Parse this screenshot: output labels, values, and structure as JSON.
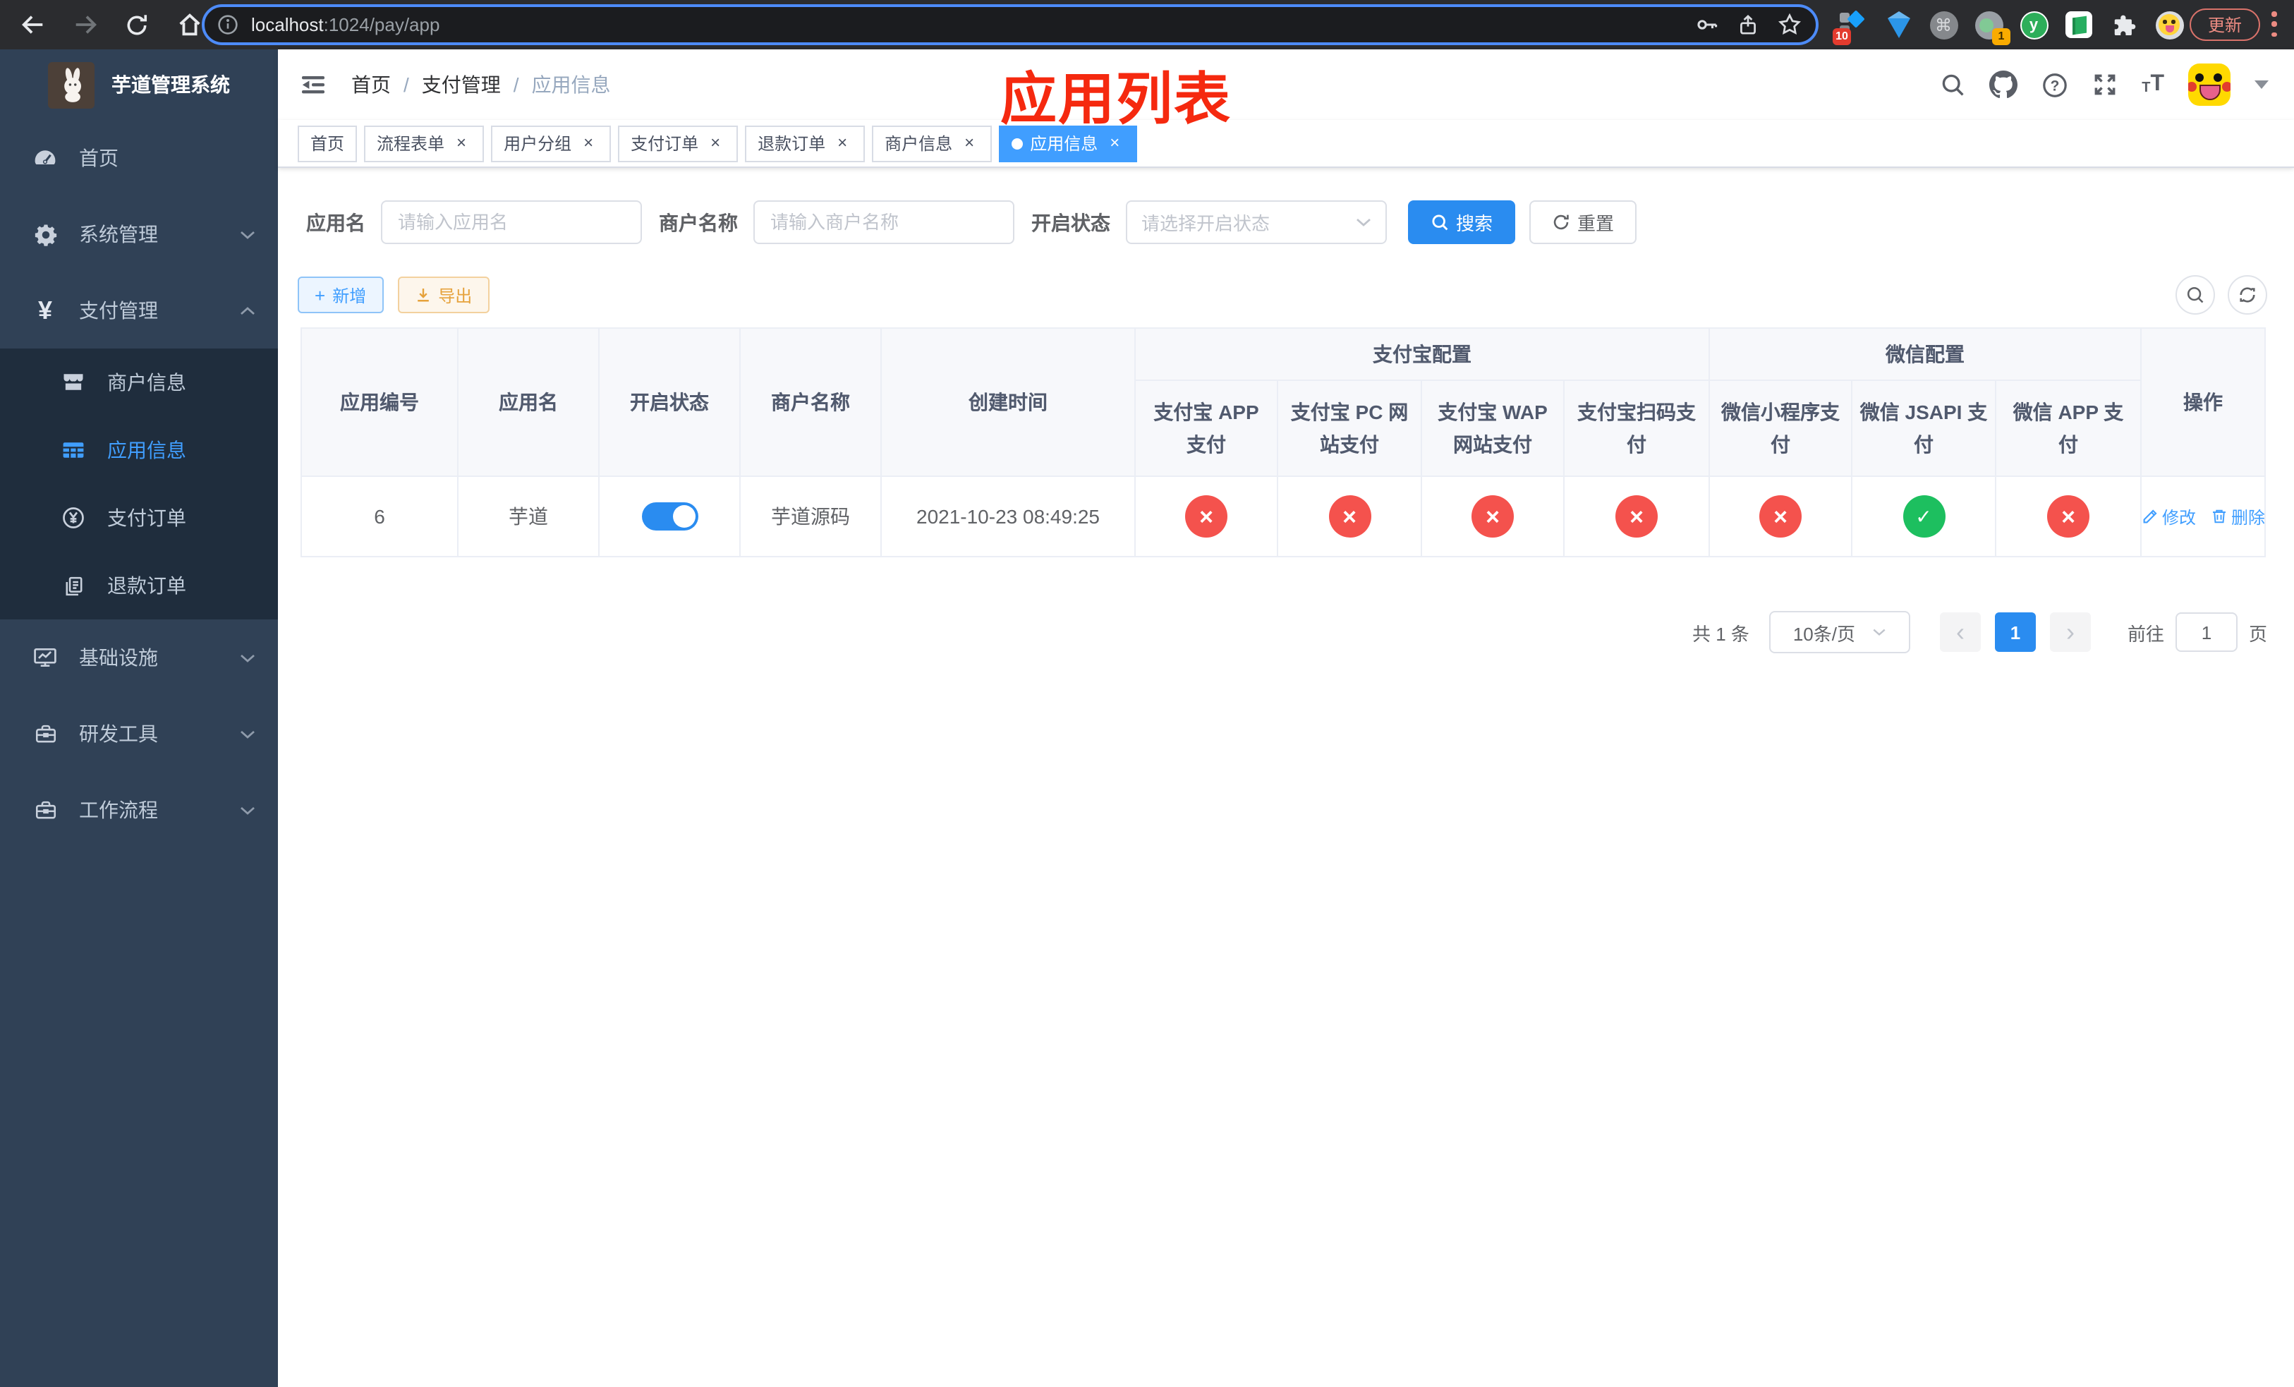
{
  "browser": {
    "url_host": "localhost",
    "url_path": ":1024/pay/app",
    "update_button": "更新",
    "ext_badge_red": "10",
    "ext_badge_orange": "1",
    "yuque_letter": "y",
    "command_glyph": "⌘"
  },
  "sidebar": {
    "title": "芋道管理系统",
    "menu": [
      {
        "label": "首页"
      },
      {
        "label": "系统管理"
      },
      {
        "label": "支付管理"
      },
      {
        "label": "商户信息"
      },
      {
        "label": "应用信息"
      },
      {
        "label": "支付订单"
      },
      {
        "label": "退款订单"
      },
      {
        "label": "基础设施"
      },
      {
        "label": "研发工具"
      },
      {
        "label": "工作流程"
      }
    ]
  },
  "navbar": {
    "breadcrumb": [
      "首页",
      "支付管理",
      "应用信息"
    ],
    "annotation": "应用列表",
    "font_icon_small": "T",
    "font_icon_large": "T"
  },
  "tabs": [
    {
      "label": "首页"
    },
    {
      "label": "流程表单"
    },
    {
      "label": "用户分组"
    },
    {
      "label": "支付订单"
    },
    {
      "label": "退款订单"
    },
    {
      "label": "商户信息"
    },
    {
      "label": "应用信息"
    }
  ],
  "filters": {
    "app_name_label": "应用名",
    "app_name_placeholder": "请输入应用名",
    "merchant_label": "商户名称",
    "merchant_placeholder": "请输入商户名称",
    "status_label": "开启状态",
    "status_placeholder": "请选择开启状态",
    "search_label": "搜索",
    "reset_label": "重置"
  },
  "toolbar": {
    "add_label": "新增",
    "export_label": "导出"
  },
  "table": {
    "columns": [
      "应用编号",
      "应用名",
      "开启状态",
      "商户名称",
      "创建时间"
    ],
    "groups": [
      {
        "label": "支付宝配置",
        "children": [
          "支付宝 APP 支付",
          "支付宝 PC 网站支付",
          "支付宝 WAP 网站支付",
          "支付宝扫码支付"
        ]
      },
      {
        "label": "微信配置",
        "children": [
          "微信小程序支付",
          "微信 JSAPI 支付",
          "微信 APP 支付"
        ]
      }
    ],
    "action_column": "操作",
    "row": {
      "id": "6",
      "name": "芋道",
      "switch_state": "on",
      "merchant": "芋道源码",
      "created": "2021-10-23 08:49:25",
      "statuses": [
        "no",
        "no",
        "no",
        "no",
        "no",
        "yes",
        "no"
      ],
      "edit_label": "修改",
      "delete_label": "删除"
    }
  },
  "pagination": {
    "total_text": "共 1 条",
    "page_size_text": "10条/页",
    "current_page": "1",
    "goto_label": "前往",
    "goto_value": "1",
    "page_unit": "页"
  },
  "colors": {
    "accent": "#409eff",
    "success": "#1dbf5f",
    "danger": "#f4524d",
    "annotation_red": "#f5290f",
    "sidebar_bg": "#304156",
    "submenu_bg": "#1f2d3d"
  }
}
